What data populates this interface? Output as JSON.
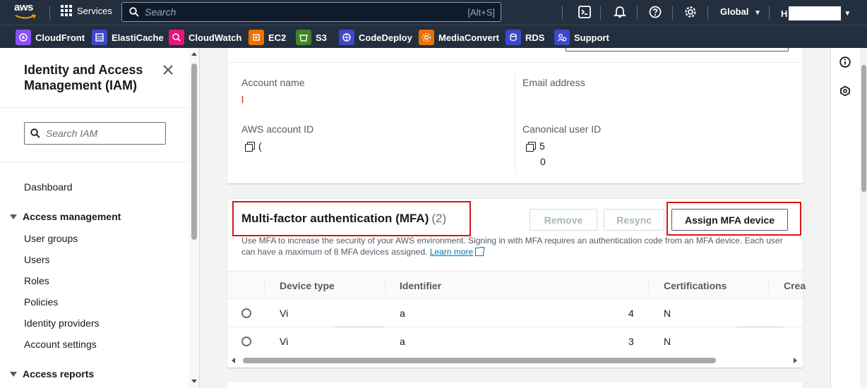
{
  "topnav": {
    "brand": "aws",
    "services_label": "Services",
    "search_placeholder": "Search",
    "search_shortcut": "[Alt+S]",
    "region_label": "Global",
    "account_initial": "H"
  },
  "favorites": [
    {
      "label": "CloudFront",
      "color": "#8c4fff"
    },
    {
      "label": "ElastiCache",
      "color": "#3b48cc"
    },
    {
      "label": "CloudWatch",
      "color": "#e7157b"
    },
    {
      "label": "EC2",
      "color": "#ed7100"
    },
    {
      "label": "S3",
      "color": "#3f8624"
    },
    {
      "label": "CodeDeploy",
      "color": "#3b48cc"
    },
    {
      "label": "MediaConvert",
      "color": "#ed7100"
    },
    {
      "label": "RDS",
      "color": "#3b48cc"
    },
    {
      "label": "Support",
      "color": "#3b48cc"
    }
  ],
  "sidebar": {
    "title": "Identity and Access Management (IAM)",
    "search_placeholder": "Search IAM",
    "dashboard": "Dashboard",
    "section_access_management": "Access management",
    "items": [
      "User groups",
      "Users",
      "Roles",
      "Policies",
      "Identity providers",
      "Account settings"
    ],
    "section_access_reports": "Access reports"
  },
  "account": {
    "account_name_label": "Account name",
    "account_name_value": "l",
    "email_label": "Email address",
    "account_id_label": "AWS account ID",
    "account_id_value": "(",
    "canonical_label": "Canonical user ID",
    "canonical_value_1": "5",
    "canonical_value_2": "0"
  },
  "mfa": {
    "title": "Multi-factor authentication (MFA)",
    "count": "(2)",
    "remove_label": "Remove",
    "resync_label": "Resync",
    "assign_label": "Assign MFA device",
    "description": "Use MFA to increase the security of your AWS environment. Signing in with MFA requires an authentication code from an MFA device. Each user can have a maximum of 8 MFA devices assigned.",
    "learn_more": "Learn more",
    "columns": [
      "Device type",
      "Identifier",
      "Certifications",
      "Crea"
    ],
    "rows": [
      {
        "device": "Vi",
        "identifier": "a",
        "num": "4",
        "cert": "N"
      },
      {
        "device": "Vi",
        "identifier": "a",
        "num": "3",
        "cert": "N"
      }
    ]
  },
  "colors": {
    "nav_bg": "#232f3e",
    "highlight": "#d91515",
    "link": "#0073bb"
  }
}
